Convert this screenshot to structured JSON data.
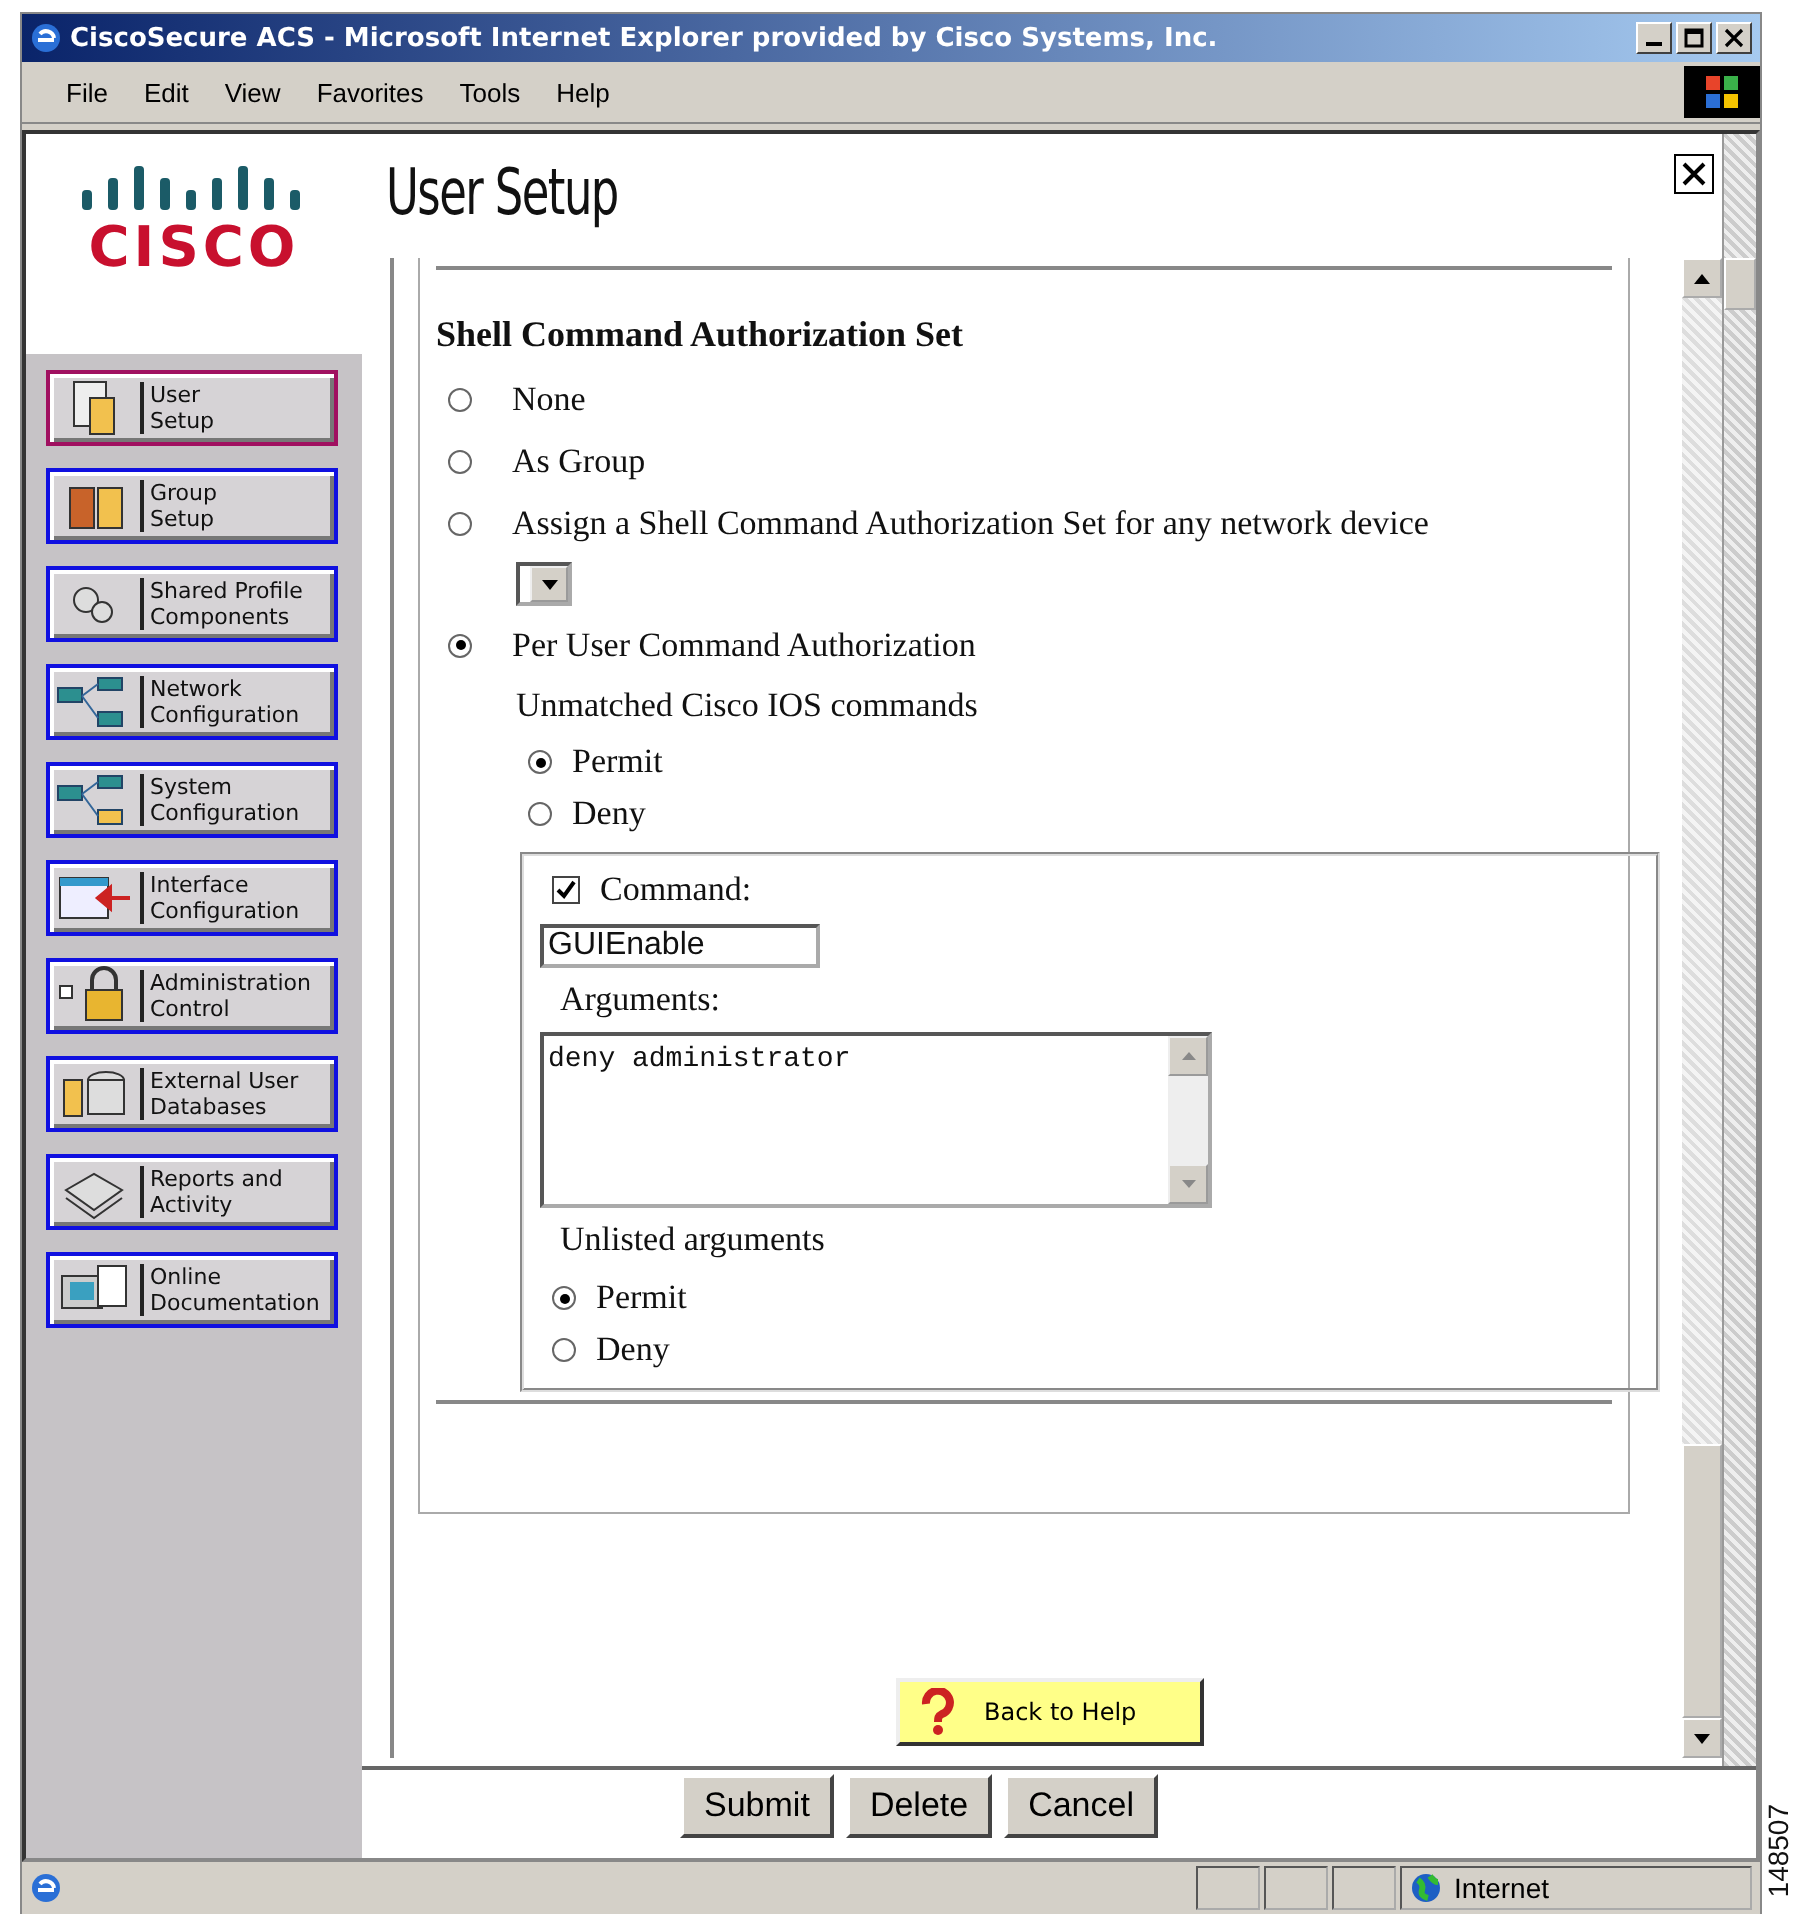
{
  "window": {
    "title": "CiscoSecure ACS - Microsoft Internet Explorer provided by Cisco Systems, Inc."
  },
  "menu": [
    "File",
    "Edit",
    "View",
    "Favorites",
    "Tools",
    "Help"
  ],
  "logo": {
    "wordmark": "CISCO"
  },
  "page_title": "User Setup",
  "sidebar": {
    "items": [
      {
        "lines": [
          "User",
          "Setup"
        ],
        "selected": true
      },
      {
        "lines": [
          "Group",
          "Setup"
        ],
        "selected": false
      },
      {
        "lines": [
          "Shared Profile",
          "Components"
        ],
        "selected": false
      },
      {
        "lines": [
          "Network",
          "Configuration"
        ],
        "selected": false
      },
      {
        "lines": [
          "System",
          "Configuration"
        ],
        "selected": false
      },
      {
        "lines": [
          "Interface",
          "Configuration"
        ],
        "selected": false
      },
      {
        "lines": [
          "Administration",
          "Control"
        ],
        "selected": false
      },
      {
        "lines": [
          "External User",
          "Databases"
        ],
        "selected": false
      },
      {
        "lines": [
          "Reports and",
          "Activity"
        ],
        "selected": false
      },
      {
        "lines": [
          "Online",
          "Documentation"
        ],
        "selected": false
      }
    ]
  },
  "section_title": "Shell Command Authorization Set",
  "shell_options": [
    {
      "label": "None",
      "selected": false,
      "kind": "plain"
    },
    {
      "label": "As Group",
      "selected": false,
      "kind": "plain"
    },
    {
      "label": "Assign a Shell Command Authorization Set for any network device",
      "selected": false,
      "kind": "dropdown"
    },
    {
      "label": "Per User Command Authorization",
      "selected": true,
      "kind": "plain"
    }
  ],
  "unmatched": {
    "label": "Unmatched Cisco IOS commands",
    "options": [
      {
        "label": "Permit",
        "selected": true
      },
      {
        "label": "Deny",
        "selected": false
      }
    ]
  },
  "command": {
    "label": "Command:",
    "checked": true,
    "value": "GUIEnable",
    "arguments_label": "Arguments:",
    "arguments": "deny administrator",
    "unlisted_label": "Unlisted arguments",
    "unlisted_options": [
      {
        "label": "Permit",
        "selected": true
      },
      {
        "label": "Deny",
        "selected": false
      }
    ]
  },
  "help_button": "Back to Help",
  "buttons": [
    "Submit",
    "Delete",
    "Cancel"
  ],
  "status_bar": {
    "zone": "Internet"
  },
  "figure_number": "148507"
}
